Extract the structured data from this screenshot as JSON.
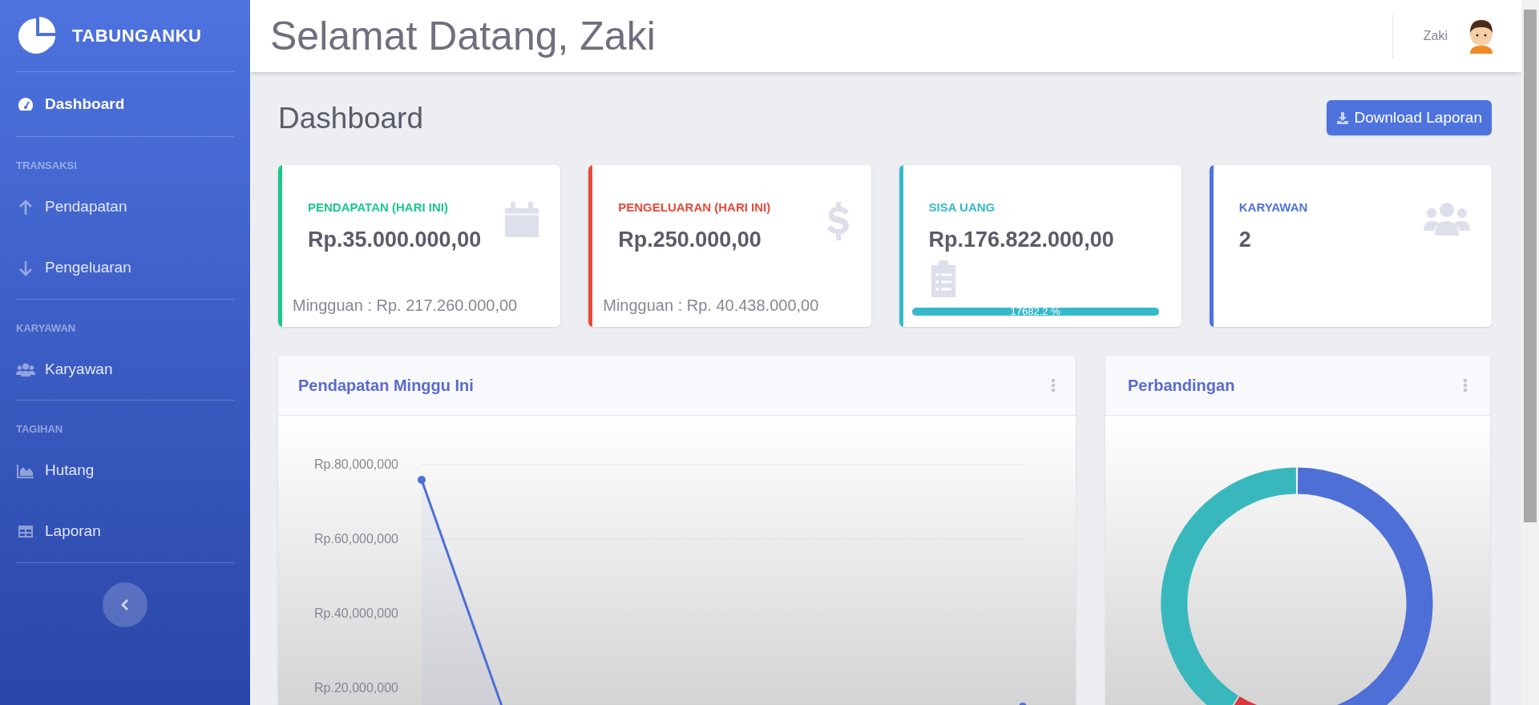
{
  "sidebar": {
    "brand": "TABUNGANKU",
    "sections": [
      {
        "items": [
          {
            "label": "Dashboard",
            "selected": true
          }
        ]
      },
      {
        "heading": "TRANSAKSI",
        "items": [
          {
            "label": "Pendapatan",
            "selected": false
          },
          {
            "label": "Pengeluaran",
            "selected": false
          }
        ]
      },
      {
        "heading": "KARYAWAN",
        "items": [
          {
            "label": "Karyawan",
            "selected": false
          }
        ]
      },
      {
        "heading": "TAGIHAN",
        "items": [
          {
            "label": "Hutang",
            "selected": false
          },
          {
            "label": "Laporan",
            "selected": false
          }
        ]
      }
    ]
  },
  "header": {
    "title": "Selamat Datang, Zaki",
    "user_name": "Zaki"
  },
  "page_heading": "Dashboard",
  "download_button": "Download Laporan",
  "stat_cards": [
    {
      "label": "PENDAPATAN (HARI INI)",
      "value": "Rp.35.000.000,00",
      "footer": "Mingguan : Rp. 217.260.000,00",
      "color": "#1cc88a"
    },
    {
      "label": "PENGELUARAN (HARI INI)",
      "value": "Rp.250.000,00",
      "footer": "Mingguan : Rp. 40.438.000,00",
      "color": "#e74a3b"
    },
    {
      "label": "SISA UANG",
      "value": "Rp.176.822.000,00",
      "progress": {
        "level": 1,
        "reading": "17682.2 %"
      },
      "color": "#36b9cc"
    },
    {
      "label": "KARYAWAN",
      "value": "2",
      "color": "#4e73df"
    }
  ],
  "income_chart": {
    "title": "Pendapatan Minggu Ini",
    "y_axis_labels": [
      "Rp.80,000,000",
      "Rp.60,000,000",
      "Rp.40,000,000",
      "Rp.20,000,000"
    ]
  },
  "comparison_chart": {
    "title": "Perbandingan"
  }
}
